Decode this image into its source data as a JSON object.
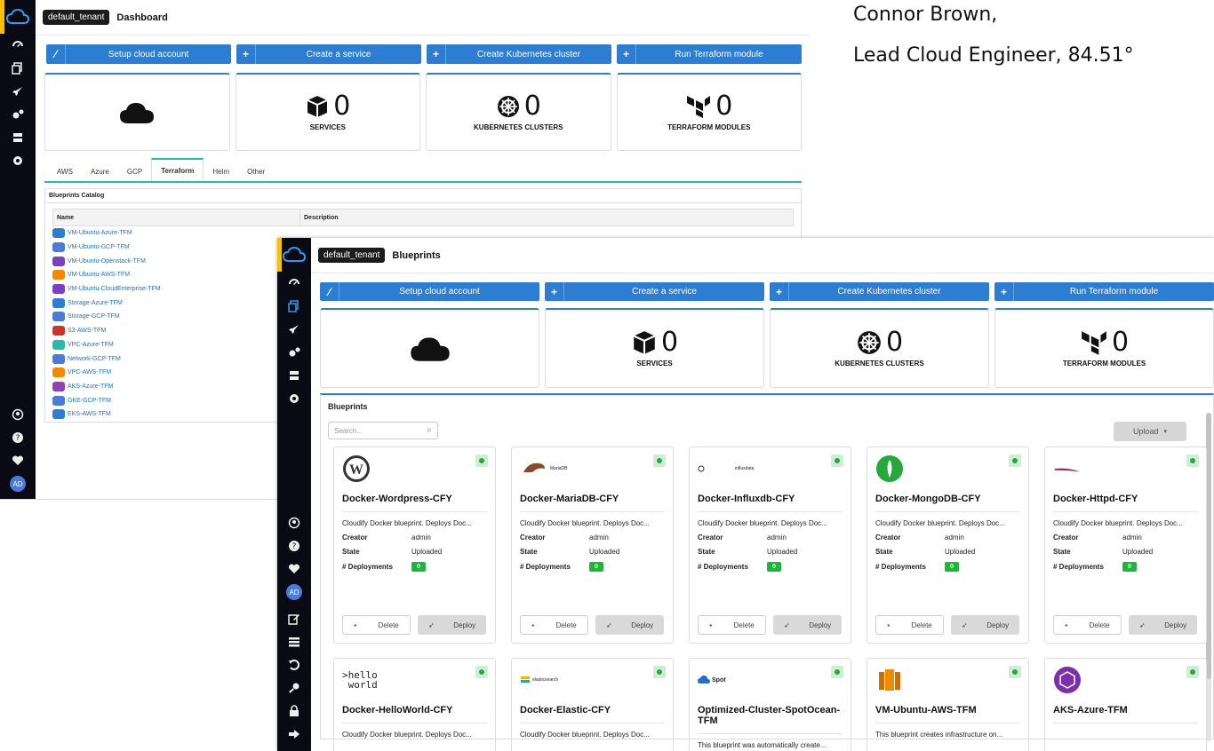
{
  "caption": {
    "line1": "Connor Brown,",
    "line2": "Lead Cloud Engineer, 84.51°"
  },
  "tenant": "default_tenant",
  "window1": {
    "title": "Dashboard",
    "buttons": [
      "Setup cloud account",
      "Create a service",
      "Create Kubernetes cluster",
      "Run Terraform module"
    ],
    "stats": [
      {
        "value": "0",
        "label": "SERVICES"
      },
      {
        "value": "0",
        "label": "KUBERNETES CLUSTERS"
      },
      {
        "value": "0",
        "label": "TERRAFORM MODULES"
      }
    ],
    "tabs": [
      "AWS",
      "Azure",
      "GCP",
      "Terraform",
      "Helm",
      "Other"
    ],
    "active_tab": "Terraform",
    "catalog_title": "Blueprints Catalog",
    "columns": [
      "Name",
      "Description"
    ],
    "items": [
      {
        "name": "VM-Ubuntu-Azure-TFM",
        "color": "#2d7dd2"
      },
      {
        "name": "VM-Ubuntu-GCP-TFM",
        "color": "#4a7bd6"
      },
      {
        "name": "VM-Ubuntu-Openstack-TFM",
        "color": "#7b3fc4"
      },
      {
        "name": "VM-Ubuntu-AWS-TFM",
        "color": "#f08a00"
      },
      {
        "name": "VM-Ubuntu-CloudEnterprise-TFM",
        "color": "#7b3fc4"
      },
      {
        "name": "Storage-Azure-TFM",
        "color": "#2d7dd2"
      },
      {
        "name": "Storage-GCP-TFM",
        "color": "#4a7bd6"
      },
      {
        "name": "S3-AWS-TFM",
        "color": "#c9352b"
      },
      {
        "name": "VPC-Azure-TFM",
        "color": "#2abba7"
      },
      {
        "name": "Network-GCP-TFM",
        "color": "#4a7bd6"
      },
      {
        "name": "VPC-AWS-TFM",
        "color": "#f08a00"
      },
      {
        "name": "AKS-Azure-TFM",
        "color": "#8e44ad"
      },
      {
        "name": "GKE-GCP-TFM",
        "color": "#4a7bd6"
      },
      {
        "name": "EKS-AWS-TFM",
        "color": "#2d7dd2"
      }
    ]
  },
  "window2": {
    "title": "Blueprints",
    "buttons": [
      "Setup cloud account",
      "Create a service",
      "Create Kubernetes cluster",
      "Run Terraform module"
    ],
    "stats": [
      {
        "value": "0",
        "label": "SERVICES"
      },
      {
        "value": "0",
        "label": "KUBERNETES CLUSTERS"
      },
      {
        "value": "0",
        "label": "TERRAFORM MODULES"
      }
    ],
    "section_title": "Blueprints",
    "search_placeholder": "Search...",
    "upload_label": "Upload",
    "field_labels": {
      "creator": "Creator",
      "state": "State",
      "deployments": "# Deployments"
    },
    "delete_label": "Delete",
    "deploy_label": "Deploy",
    "cards": [
      {
        "name": "Docker-Wordpress-CFY",
        "desc": "Cloudify Docker blueprint. Deploys Doc...",
        "creator": "admin",
        "state": "Uploaded",
        "deployments": "0",
        "logo": "wordpress",
        "logo_text": ""
      },
      {
        "name": "Docker-MariaDB-CFY",
        "desc": "Cloudify Docker blueprint. Deploys Doc...",
        "creator": "admin",
        "state": "Uploaded",
        "deployments": "0",
        "logo": "mariadb",
        "logo_text": "MariaDB"
      },
      {
        "name": "Docker-Influxdb-CFY",
        "desc": "Cloudify Docker blueprint. Deploys Doc...",
        "creator": "admin",
        "state": "Uploaded",
        "deployments": "0",
        "logo": "influx",
        "logo_text": "influxdata"
      },
      {
        "name": "Docker-MongoDB-CFY",
        "desc": "Cloudify Docker blueprint. Deploys Doc...",
        "creator": "admin",
        "state": "Uploaded",
        "deployments": "0",
        "logo": "mongo",
        "logo_text": ""
      },
      {
        "name": "Docker-Httpd-CFY",
        "desc": "Cloudify Docker blueprint. Deploys Doc...",
        "creator": "admin",
        "state": "Uploaded",
        "deployments": "0",
        "logo": "httpd",
        "logo_text": ""
      },
      {
        "name": "Docker-HelloWorld-CFY",
        "desc": "Cloudify Docker blueprint. Deploys Doc...",
        "logo": "hello",
        "logo_text": ">hello\n world"
      },
      {
        "name": "Docker-Elastic-CFY",
        "desc": "Cloudify Docker blueprint. Deploys Doc...",
        "logo": "elastic",
        "logo_text": "elasticsearch"
      },
      {
        "name": "Optimized-Cluster-SpotOcean-TFM",
        "desc": "This blueprint was automatically create...",
        "logo": "spot",
        "logo_text": "Spot"
      },
      {
        "name": "VM-Ubuntu-AWS-TFM",
        "desc": "This blueprint creates infrastructure on...",
        "logo": "aws",
        "logo_text": ""
      },
      {
        "name": "AKS-Azure-TFM",
        "desc": "",
        "logo": "aks",
        "logo_text": ""
      }
    ]
  }
}
